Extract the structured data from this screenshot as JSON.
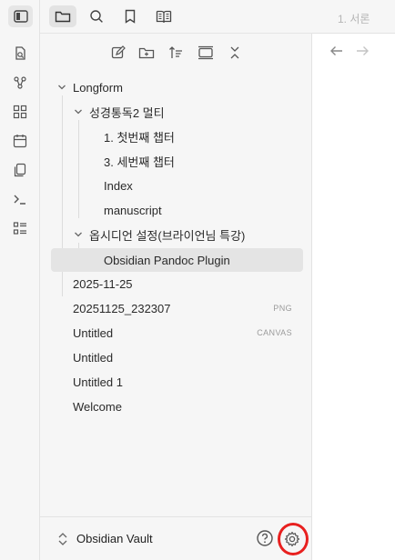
{
  "ribbon": {
    "icons": [
      "sidebar-toggle-icon",
      "quick-switcher-icon",
      "graph-view-icon",
      "canvas-icon",
      "daily-note-icon",
      "templates-icon",
      "command-palette-icon",
      "bases-icon"
    ]
  },
  "sidebar_tabs": [
    "files-icon",
    "search-icon",
    "bookmark-icon",
    "longform-book-icon"
  ],
  "nav_actions": [
    "new-note-icon",
    "new-folder-icon",
    "sort-icon",
    "auto-reveal-icon",
    "collapse-all-icon"
  ],
  "tree": {
    "root": "Longform",
    "folder1": "성경통독2 멀티",
    "f1_items": [
      "1. 첫번째 챕터",
      "3. 세번째 챕터",
      "Index",
      "manuscript"
    ],
    "folder2": "옵시디언 설정(브라이언님 특강)",
    "f2_items": [
      "Obsidian Pandoc Plugin"
    ],
    "files": [
      {
        "name": "2025-11-25",
        "badge": ""
      },
      {
        "name": "20251125_232307",
        "badge": "PNG"
      },
      {
        "name": "Untitled",
        "badge": "CANVAS"
      },
      {
        "name": "Untitled",
        "badge": ""
      },
      {
        "name": "Untitled 1",
        "badge": ""
      },
      {
        "name": "Welcome",
        "badge": ""
      }
    ]
  },
  "vault": {
    "name": "Obsidian Vault"
  },
  "right_pane": {
    "tab_title": "1. 서론"
  },
  "colors": {
    "accent_highlight": "#e8201f",
    "sidebar_bg": "#f6f6f6"
  }
}
